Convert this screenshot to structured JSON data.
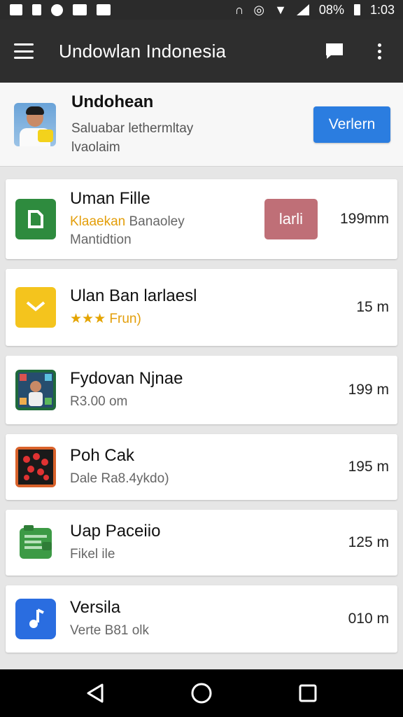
{
  "status_bar": {
    "battery_percent": "08%",
    "time": "1:03",
    "icons": [
      "notification-icon",
      "sim-icon",
      "sync-icon",
      "message-icon",
      "mail-icon",
      "headset-icon",
      "alarm-icon",
      "wifi-icon",
      "signal-icon",
      "battery-icon"
    ]
  },
  "toolbar": {
    "title": "Undowlan Indonesia",
    "menu_icon": "menu-icon",
    "chat_icon": "chat-icon",
    "overflow_icon": "more-vert-icon"
  },
  "profile": {
    "name": "Undohean",
    "subtitle_line1": "Saluabar lethermltay",
    "subtitle_line2": "lvaolaim",
    "button_label": "Verlern"
  },
  "items": [
    {
      "title": "Uman Fille",
      "sub_highlight": "Klaaekan",
      "sub_rest": " Banaoley",
      "sub_line2": "Mantidtion",
      "action_label": "larli",
      "size": "199mm",
      "icon": "app-icon-green",
      "icon_color": "#2e8b3e"
    },
    {
      "title": "Ulan Ban larlaesl",
      "stars": "★★★",
      "sub_rest": " Frun)",
      "size": "15 m",
      "icon": "app-icon-yellow-mail",
      "icon_color": "#f4c41d"
    },
    {
      "title": "Fydovan Njnae",
      "sub_line1": "R3.00 om",
      "size": "199 m",
      "icon": "app-icon-photo-grid"
    },
    {
      "title": "Poh Cak",
      "sub_line1": "Dale Ra8.4ykdo)",
      "size": "195 m",
      "icon": "app-icon-red-dots"
    },
    {
      "title": "Uap Paceiio",
      "sub_line1": "Fikel ile",
      "size": "125 m",
      "icon": "app-icon-green-wallet",
      "icon_color": "#3c9a45"
    },
    {
      "title": "Versila",
      "sub_line1": "Verte B81 olk",
      "size": "010 m",
      "icon": "app-icon-music",
      "icon_color": "#2a6de0"
    }
  ],
  "nav_bar": {
    "back_icon": "back-triangle-icon",
    "home_icon": "home-circle-icon",
    "recents_icon": "recents-square-icon"
  },
  "colors": {
    "toolbar_bg": "#2e2e2e",
    "primary_button": "#2b7de0",
    "action_pill": "#bf6f77",
    "highlight": "#e39e0a"
  }
}
